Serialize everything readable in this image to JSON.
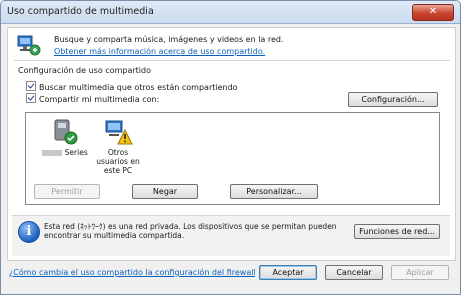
{
  "window": {
    "title": "Uso compartido de multimedia",
    "close_label": "✕"
  },
  "header": {
    "description": "Busque y comparta música, imágenes y videos en la red.",
    "more_info_link": "Obtener más información acerca de uso compartido."
  },
  "sharing": {
    "group_title": "Configuración de uso compartido",
    "find_media_label": "Buscar multimedia que otros están compartiendo",
    "share_media_label": "Compartir mi multimedia con:",
    "settings_button": "Configuración...",
    "devices": [
      {
        "name": "Series",
        "icon": "media-device-icon"
      },
      {
        "name": "Otros usuarios en este PC",
        "icon": "users-warning-icon"
      }
    ],
    "allow_button": "Permitir",
    "deny_button": "Negar",
    "customize_button": "Personalizar..."
  },
  "info": {
    "text": "Esta red (ﾈｯﾄﾜｰｸ) es una red privada. Los dispositivos que se permitan pueden encontrar su multimedia compartida.",
    "network_functions_button": "Funciones de red..."
  },
  "footer": {
    "firewall_link": "¿Cómo cambia el uso compartido la configuración del firewall?",
    "accept_button": "Aceptar",
    "cancel_button": "Cancelar",
    "apply_button": "Aplicar"
  }
}
